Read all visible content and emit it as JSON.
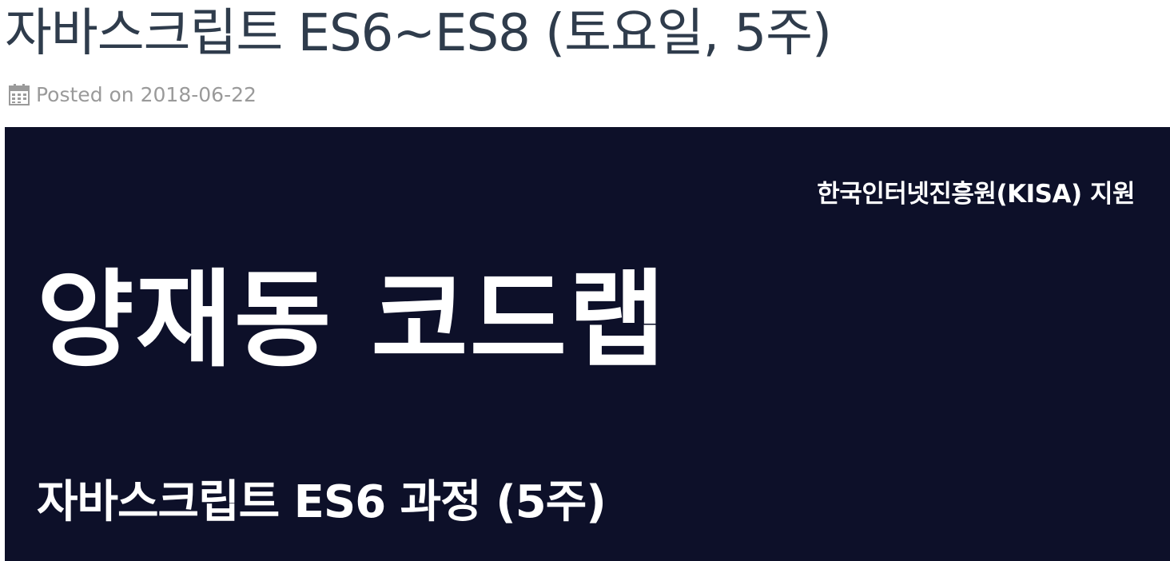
{
  "post": {
    "title": "자바스크립트 ES6~ES8 (토요일, 5주)",
    "meta": {
      "icon": "calendar-icon",
      "posted_label": "Posted on",
      "date": "2018-06-22"
    }
  },
  "banner": {
    "background_color": "#0d1029",
    "support": "한국인터넷진흥원(KISA) 지원",
    "title": "양재동 코드랩",
    "course": "자바스크립트 ES6 과정 (5주)"
  }
}
